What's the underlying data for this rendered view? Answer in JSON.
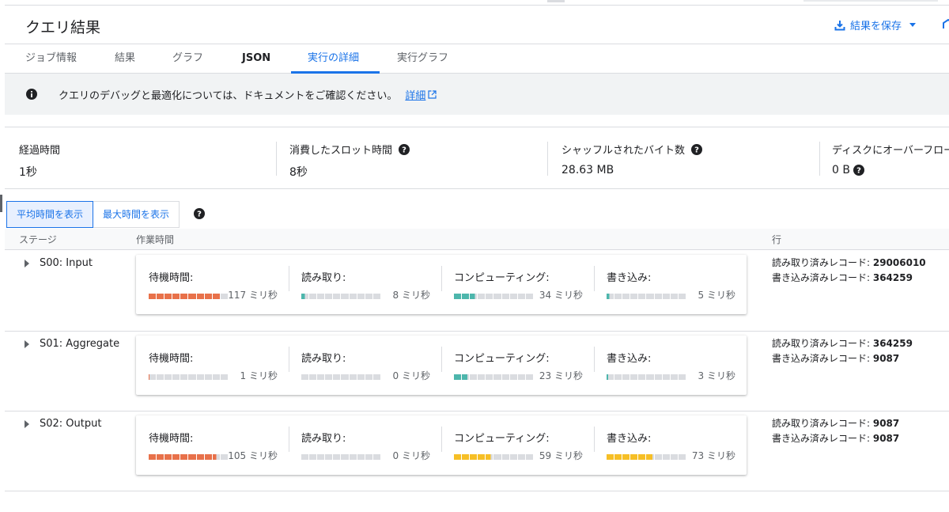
{
  "header": {
    "title": "クエリ結果",
    "save_label": "結果を保存"
  },
  "tabs": [
    {
      "label": "ジョブ情報"
    },
    {
      "label": "結果"
    },
    {
      "label": "グラフ"
    },
    {
      "label": "JSON"
    },
    {
      "label": "実行の詳細",
      "active": true
    },
    {
      "label": "実行グラフ"
    }
  ],
  "banner": {
    "text": "クエリのデバッグと最適化については、ドキュメントをご確認ください。",
    "link": "詳細"
  },
  "stats": [
    {
      "label": "経過時間",
      "value": "1秒"
    },
    {
      "label": "消費したスロット時間",
      "value": "8秒"
    },
    {
      "label": "シャッフルされたバイト数",
      "value": "28.63 MB"
    },
    {
      "label": "ディスクにオーバーフロー",
      "value": "0 B"
    }
  ],
  "toggle": {
    "avg": "平均時間を表示",
    "max": "最大時間を表示"
  },
  "table_header": {
    "stage": "ステージ",
    "work": "作業時間",
    "rows": "行"
  },
  "metric_labels": {
    "wait": "待機時間:",
    "read": "読み取り:",
    "compute": "コンピューティング:",
    "write": "書き込み:"
  },
  "record_labels": {
    "read": "読み取り済みレコード: ",
    "written": "書き込み済みレコード: "
  },
  "colors": {
    "wait": "#e8714a",
    "compute_low": "#4db6ac",
    "compute_high": "#f6bf26",
    "empty": "#dadce0",
    "accent": "#1a73e8"
  },
  "stages": [
    {
      "name": "S00: Input",
      "wait": {
        "value": "117 ミリ秒",
        "fill": 0.9
      },
      "read": {
        "value": "8 ミリ秒",
        "fill": 0.05
      },
      "compute": {
        "value": "34 ミリ秒",
        "fill": 0.27
      },
      "write": {
        "value": "5 ミリ秒",
        "fill": 0.04
      },
      "records_read": "29006010",
      "records_written": "364259"
    },
    {
      "name": "S01: Aggregate",
      "wait": {
        "value": "1 ミリ秒",
        "fill": 0.01
      },
      "read": {
        "value": "0 ミリ秒",
        "fill": 0
      },
      "compute": {
        "value": "23 ミリ秒",
        "fill": 0.18
      },
      "write": {
        "value": "3 ミリ秒",
        "fill": 0.02
      },
      "records_read": "364259",
      "records_written": "9087"
    },
    {
      "name": "S02: Output",
      "wait": {
        "value": "105 ミリ秒",
        "fill": 0.85
      },
      "read": {
        "value": "0 ミリ秒",
        "fill": 0
      },
      "compute": {
        "value": "59 ミリ秒",
        "fill": 0.47
      },
      "write": {
        "value": "73 ミリ秒",
        "fill": 0.58
      },
      "records_read": "9087",
      "records_written": "9087"
    }
  ]
}
